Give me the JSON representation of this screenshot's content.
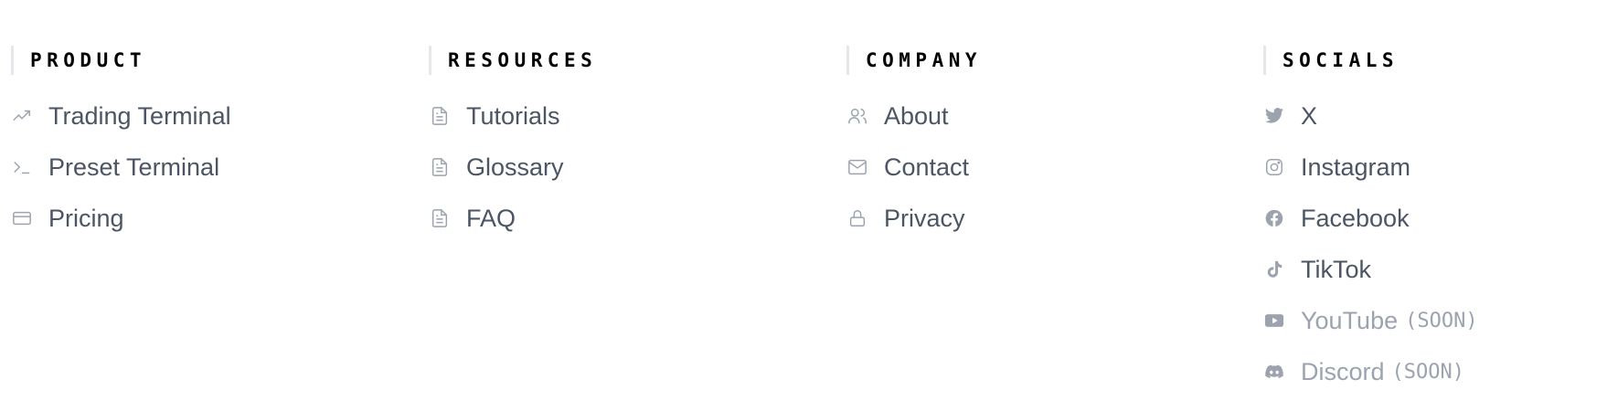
{
  "columns": [
    {
      "title": "PRODUCT",
      "items": [
        {
          "label": "Trading Terminal",
          "icon": "trending-up-icon"
        },
        {
          "label": "Preset Terminal",
          "icon": "terminal-icon"
        },
        {
          "label": "Pricing",
          "icon": "credit-card-icon"
        }
      ]
    },
    {
      "title": "RESOURCES",
      "items": [
        {
          "label": "Tutorials",
          "icon": "document-icon"
        },
        {
          "label": "Glossary",
          "icon": "document-icon"
        },
        {
          "label": "FAQ",
          "icon": "document-icon"
        }
      ]
    },
    {
      "title": "COMPANY",
      "items": [
        {
          "label": "About",
          "icon": "users-icon"
        },
        {
          "label": "Contact",
          "icon": "mail-icon"
        },
        {
          "label": "Privacy",
          "icon": "lock-icon"
        }
      ]
    },
    {
      "title": "SOCIALS",
      "items": [
        {
          "label": "X",
          "icon": "twitter-icon"
        },
        {
          "label": "Instagram",
          "icon": "instagram-icon"
        },
        {
          "label": "Facebook",
          "icon": "facebook-icon"
        },
        {
          "label": "TikTok",
          "icon": "tiktok-icon"
        },
        {
          "label": "YouTube",
          "icon": "youtube-icon",
          "tag": "(SOON)"
        },
        {
          "label": "Discord",
          "icon": "discord-icon",
          "tag": "(SOON)"
        }
      ]
    }
  ],
  "colors": {
    "heading": "#000000",
    "link": "#4b5563",
    "icon": "#9ca3af",
    "muted": "#9ca3af",
    "accent_bar": "#e5e7eb"
  }
}
